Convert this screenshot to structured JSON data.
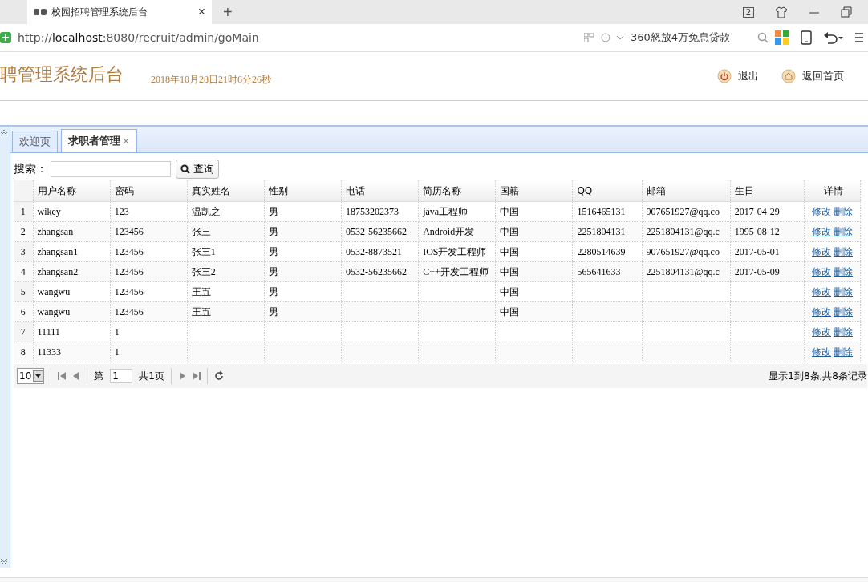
{
  "browser": {
    "tab_title": "校园招聘管理系统后台",
    "tab_close": "×",
    "new_tab": "+",
    "tab_count": "2",
    "url_prefix": "http://",
    "url_host": "localhost",
    "url_rest": ":8080/recruit/admin/goMain",
    "search_text": "360怒放4万免息贷款"
  },
  "header": {
    "title": "聘管理系统后台",
    "datetime": "2018年10月28日21时6分26秒",
    "actions": [
      {
        "label": "退出"
      },
      {
        "label": "返回首页"
      }
    ]
  },
  "tabs": [
    {
      "label": "欢迎页",
      "selected": false,
      "closable": false
    },
    {
      "label": "求职者管理",
      "selected": true,
      "closable": true
    }
  ],
  "tab_close": "×",
  "search": {
    "label": "搜索：",
    "button": "查询"
  },
  "table": {
    "columns": [
      "用户名称",
      "密码",
      "真实姓名",
      "性别",
      "电话",
      "简历名称",
      "国籍",
      "QQ",
      "邮箱",
      "生日",
      "详情"
    ],
    "rows": [
      {
        "index": "1",
        "cells": [
          "wikey",
          "123",
          "温凯之",
          "男",
          "18753202373",
          "java工程师",
          "中国",
          "1516465131",
          "907651927@qq.co",
          "2017-04-29"
        ],
        "actions": [
          "修改",
          "删除"
        ]
      },
      {
        "index": "2",
        "cells": [
          "zhangsan",
          "123456",
          "张三",
          "男",
          "0532-56235662",
          "Android开发",
          "中国",
          "2251804131",
          "2251804131@qq.c",
          "1995-08-12"
        ],
        "actions": [
          "修改",
          "删除"
        ]
      },
      {
        "index": "3",
        "cells": [
          "zhangsan1",
          "123456",
          "张三1",
          "男",
          "0532-8873521",
          "IOS开发工程师",
          "中国",
          "2280514639",
          "907651927@qq.co",
          "2017-05-01"
        ],
        "actions": [
          "修改",
          "删除"
        ]
      },
      {
        "index": "4",
        "cells": [
          "zhangsan2",
          "123456",
          "张三2",
          "男",
          "0532-56235662",
          "C++开发工程师",
          "中国",
          "565641633",
          "2251804131@qq.c",
          "2017-05-09"
        ],
        "actions": [
          "修改",
          "删除"
        ]
      },
      {
        "index": "5",
        "cells": [
          "wangwu",
          "123456",
          "王五",
          "男",
          "",
          "",
          "中国",
          "",
          "",
          "",
          ""
        ],
        "actions": [
          "修改",
          "删除"
        ]
      },
      {
        "index": "6",
        "cells": [
          "wangwu",
          "123456",
          "王五",
          "男",
          "",
          "",
          "中国",
          "",
          "",
          ""
        ],
        "actions": [
          "修改",
          "删除"
        ]
      },
      {
        "index": "7",
        "cells": [
          "11111",
          "1",
          "",
          "",
          "",
          "",
          "",
          "",
          "",
          ""
        ],
        "actions": [
          "修改",
          "删除"
        ]
      },
      {
        "index": "8",
        "cells": [
          "11333",
          "1",
          "",
          "",
          "",
          "",
          "",
          "",
          "",
          ""
        ],
        "actions": [
          "修改",
          "删除"
        ]
      }
    ]
  },
  "pager": {
    "page_size": "10",
    "page_label": "第",
    "page": "1",
    "total_pages": "共1页",
    "summary": "显示1到8条,共8条记录"
  }
}
